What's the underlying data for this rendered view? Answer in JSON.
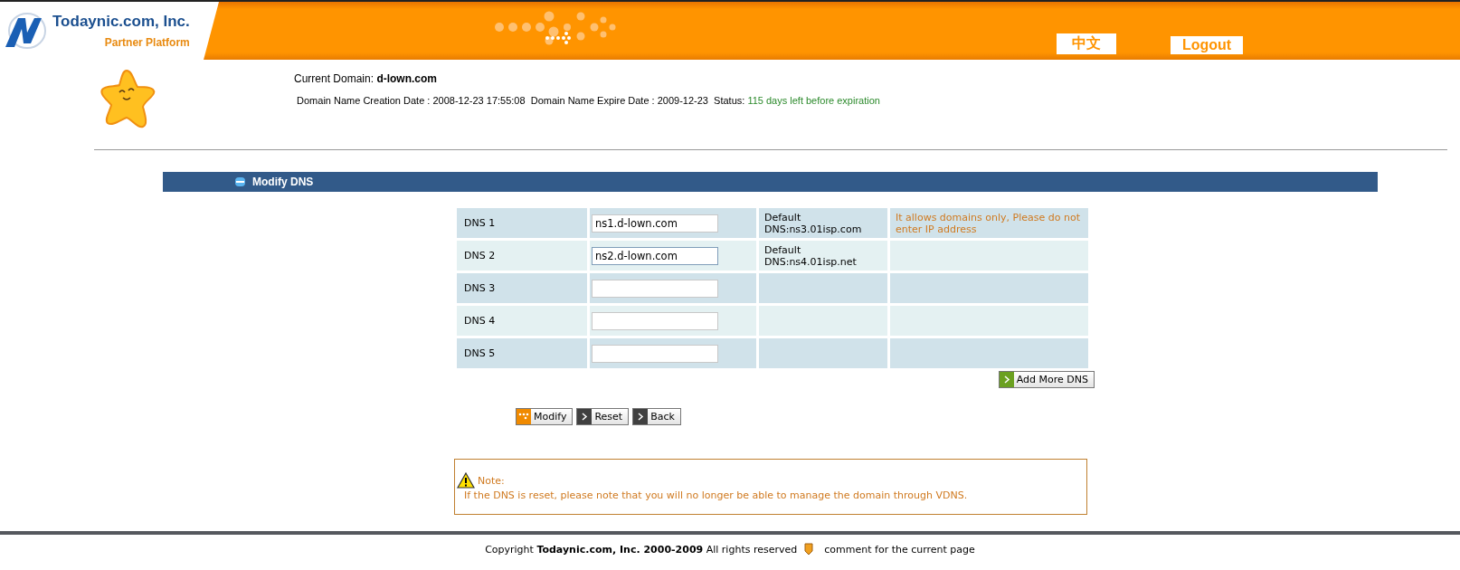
{
  "header": {
    "company": "Todaynic.com, Inc.",
    "subtitle": "Partner Platform",
    "links": [
      "中文",
      "Logout"
    ]
  },
  "domain": {
    "label": "Current Domain:",
    "name": "d-lown.com",
    "details": "Domain Name Creation Date : 2008-12-23 17:55:08  Domain Name Expire Date : 2009-12-23   Status:",
    "status": "115 days left before expiration"
  },
  "section": {
    "title": "Modify DNS"
  },
  "dns_rows": [
    {
      "label": "DNS 1",
      "value": "ns1.d-lown.com",
      "focused": false,
      "default": "Default DNS:ns3.01isp.com",
      "hint": "It allows domains only, Please do not enter IP address"
    },
    {
      "label": "DNS 2",
      "value": "ns2.d-lown.com",
      "focused": true,
      "default": "Default DNS:ns4.01isp.net"
    },
    {
      "label": "DNS 3",
      "focused": false
    },
    {
      "label": "DNS 4",
      "focused": false
    },
    {
      "label": "DNS 5",
      "focused": false
    }
  ],
  "add_button": "Add More DNS",
  "actions": [
    {
      "label": "Modify",
      "kind": "primary"
    },
    {
      "label": "Reset",
      "kind": "arrow"
    },
    {
      "label": "Back",
      "kind": "arrow"
    }
  ],
  "note": {
    "title": "Note:",
    "text": "If the DNS is reset, please note that you will no longer be able to manage the domain through VDNS."
  },
  "footer": {
    "copyright": "Copyright **Todaynic.com, Inc. 2000-2009** All rights reserved",
    "link": "comment for the current page"
  }
}
